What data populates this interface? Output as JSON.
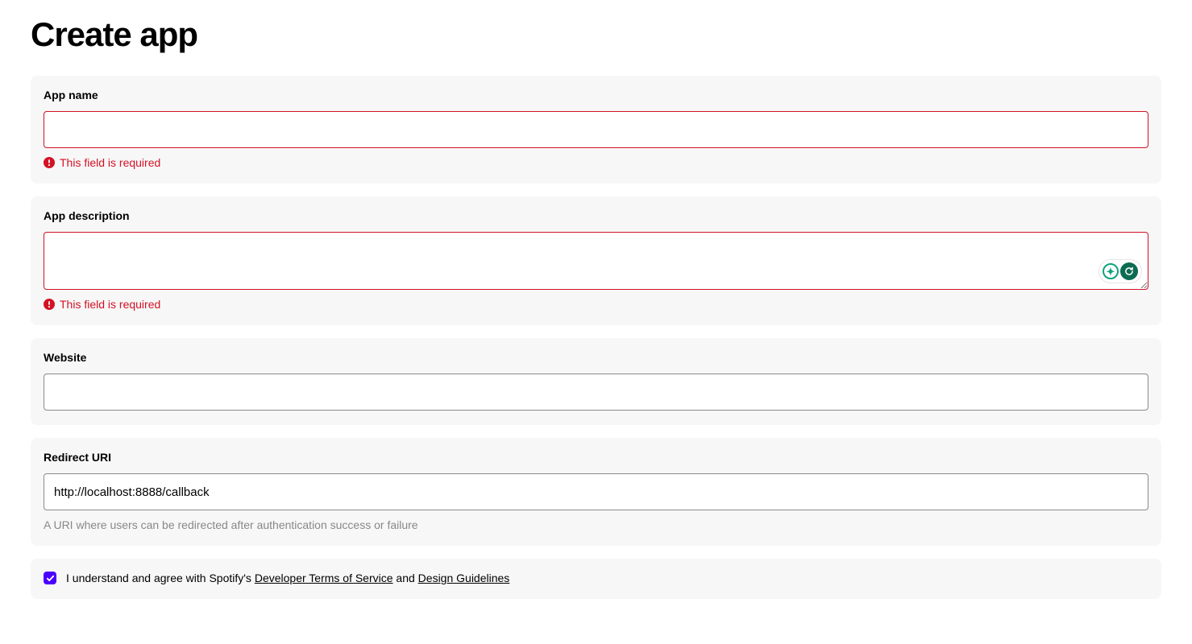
{
  "title": "Create app",
  "fields": {
    "app_name": {
      "label": "App name",
      "value": "",
      "error": "This field is required"
    },
    "app_description": {
      "label": "App description",
      "value": "",
      "error": "This field is required"
    },
    "website": {
      "label": "Website",
      "value": ""
    },
    "redirect_uri": {
      "label": "Redirect URI",
      "value": "http://localhost:8888/callback",
      "help": "A URI where users can be redirected after authentication success or failure"
    }
  },
  "agreement": {
    "checked": true,
    "prefix": "I understand and agree with Spotify's ",
    "link1": "Developer Terms of Service",
    "mid": " and ",
    "link2": "Design Guidelines"
  }
}
